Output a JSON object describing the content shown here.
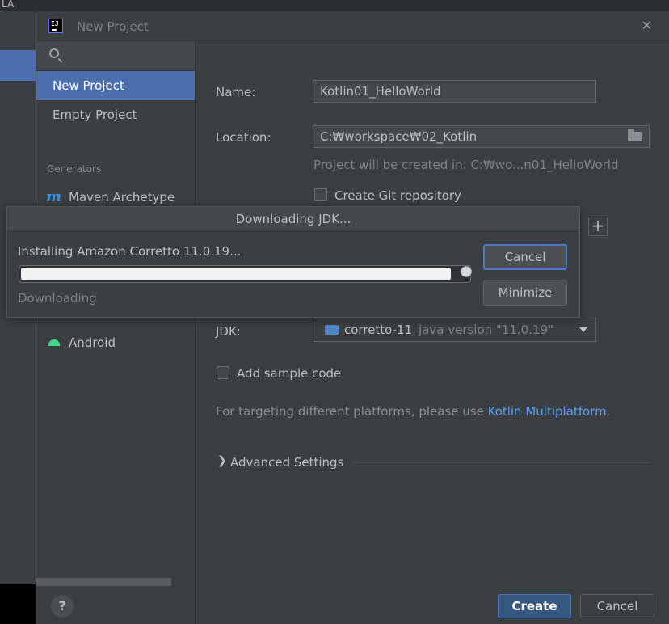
{
  "background": {
    "corner_text": "LA"
  },
  "window": {
    "title": "New Project",
    "app_icon_text": "IJ"
  },
  "sidebar": {
    "items": [
      {
        "label": "New Project",
        "selected": true
      },
      {
        "label": "Empty Project",
        "selected": false
      }
    ],
    "section": "Generators",
    "generators": [
      {
        "label": "Maven Archetype",
        "icon": "maven-icon",
        "glyph": "m"
      },
      {
        "label": "Android",
        "icon": "android-icon"
      }
    ]
  },
  "form": {
    "name_label": "Name:",
    "name_value": "Kotlin01_HelloWorld",
    "location_label": "Location:",
    "location_value": "C:₩workspace₩02_Kotlin",
    "location_hint": "Project will be created in: C:₩wo...n01_HelloWorld",
    "git_label": "Create Git repository",
    "git_checked": false,
    "plus_label": "+",
    "jdk_label": "JDK:",
    "jdk_name": "corretto-11",
    "jdk_version": "java version \"11.0.19\"",
    "sample_label": "Add sample code",
    "sample_checked": false,
    "info_text": "For targeting different platforms, please use ",
    "info_link": "Kotlin Multiplatform",
    "info_suffix": ".",
    "advanced_label": "Advanced Settings",
    "advanced_chevron": "❯"
  },
  "footer": {
    "help": "?",
    "create": "Create",
    "cancel": "Cancel"
  },
  "download_dialog": {
    "title": "Downloading JDK...",
    "message": "Installing Amazon Corretto 11.0.19...",
    "progress": 0.96,
    "status": "Downloading",
    "cancel": "Cancel",
    "minimize": "Minimize"
  },
  "colors": {
    "accent": "#4b6eaf",
    "link": "#589df6",
    "primary_button": "#365880"
  }
}
